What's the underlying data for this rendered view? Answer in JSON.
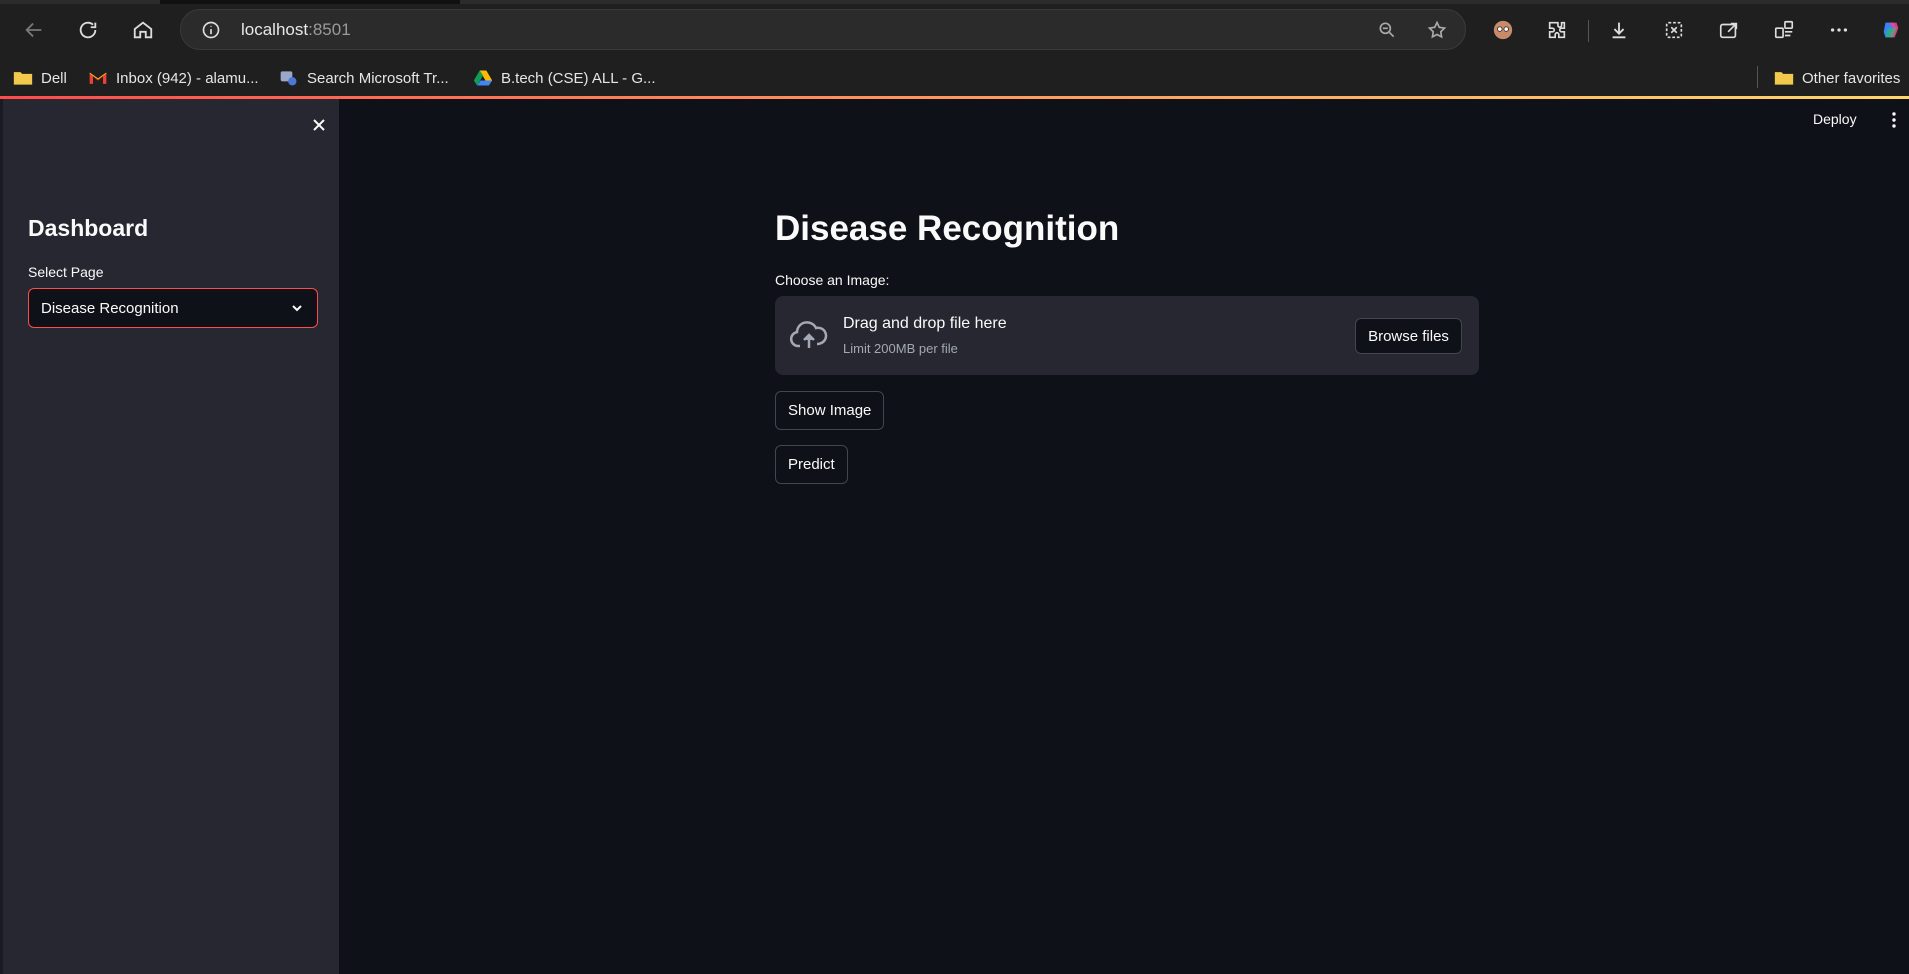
{
  "browser": {
    "url_host": "localhost",
    "url_port": ":8501",
    "bookmarks": [
      {
        "label": "Dell",
        "icon": "folder-icon"
      },
      {
        "label": "Inbox (942) - alamu...",
        "icon": "gmail-icon"
      },
      {
        "label": "Search Microsoft Tr...",
        "icon": "microsoft-search-icon"
      },
      {
        "label": "B.tech (CSE) ALL - G...",
        "icon": "google-drive-icon"
      }
    ],
    "other_favorites": "Other favorites"
  },
  "sidebar": {
    "title": "Dashboard",
    "select_label": "Select Page",
    "select_value": "Disease Recognition"
  },
  "header": {
    "deploy_label": "Deploy"
  },
  "main": {
    "title": "Disease Recognition",
    "uploader_label": "Choose an Image:",
    "upload_title": "Drag and drop file here",
    "upload_limit": "Limit 200MB per file",
    "browse_label": "Browse files",
    "show_image_label": "Show Image",
    "predict_label": "Predict"
  },
  "colors": {
    "accent": "#ff4b4b",
    "background": "#0e1117",
    "sidebar": "#262730"
  }
}
